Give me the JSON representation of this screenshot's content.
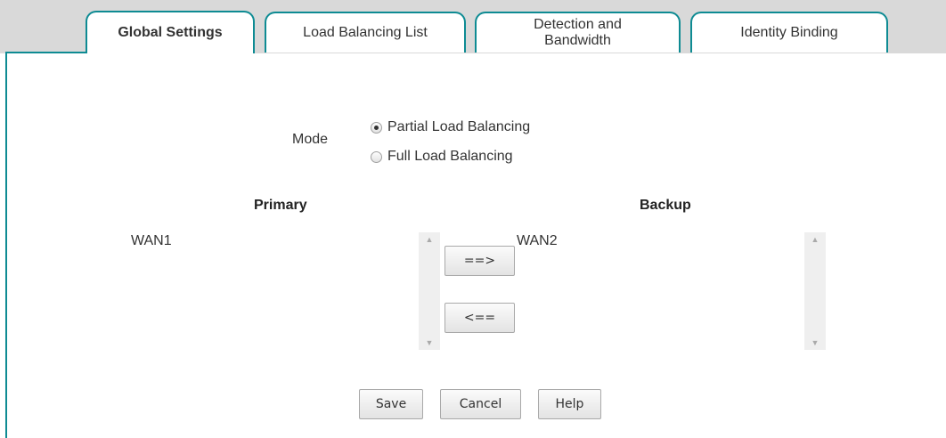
{
  "tabs": [
    {
      "label": "Global Settings"
    },
    {
      "label": "Load Balancing List"
    },
    {
      "label": "Detection and Bandwidth"
    },
    {
      "label": "Identity Binding"
    }
  ],
  "mode": {
    "label": "Mode",
    "options": [
      {
        "label": "Partial Load Balancing",
        "selected": true
      },
      {
        "label": "Full Load Balancing",
        "selected": false
      }
    ]
  },
  "primary": {
    "header": "Primary",
    "items": [
      "WAN1"
    ]
  },
  "backup": {
    "header": "Backup",
    "items": [
      "WAN2"
    ]
  },
  "move": {
    "to_backup": "==>",
    "to_primary": "<=="
  },
  "actions": {
    "save": "Save",
    "cancel": "Cancel",
    "help": "Help"
  }
}
